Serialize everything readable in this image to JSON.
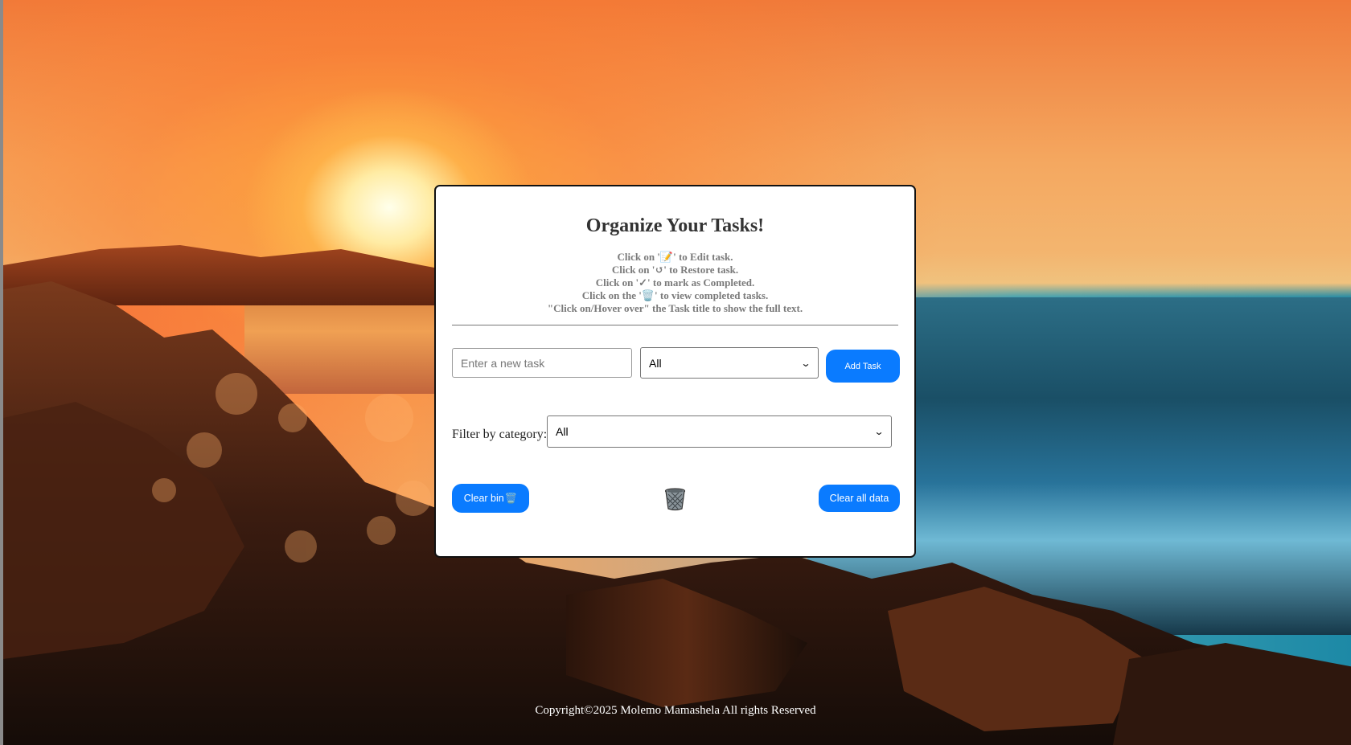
{
  "page": {
    "title": "Organize Your Tasks!",
    "instructions": [
      "Click on '📝' to Edit task.",
      "Click on '↺' to Restore task.",
      "Click on '✓' to mark as Completed.",
      "Click on the '🗑️' to view completed tasks.",
      "\"Click on/Hover over\" the Task title to show the full text."
    ]
  },
  "form": {
    "task_placeholder": "Enter a new task",
    "category_selected": "All",
    "add_button_label": "Add Task"
  },
  "filter": {
    "label": "Filter by category:",
    "selected": "All"
  },
  "actions": {
    "clear_bin_label": "Clear bin",
    "clear_bin_glyph": "🗑️",
    "bin_icon": "trash-bin-icon",
    "clear_all_label": "Clear all data"
  },
  "footer": {
    "copyright_prefix": "Copyright©2025 ",
    "author": "Molemo Mamashela",
    "rights": " All rights Reserved"
  },
  "colors": {
    "accent": "#0a7bff",
    "card_bg": "#ffffff",
    "instruction_text": "#7a7a7a"
  }
}
